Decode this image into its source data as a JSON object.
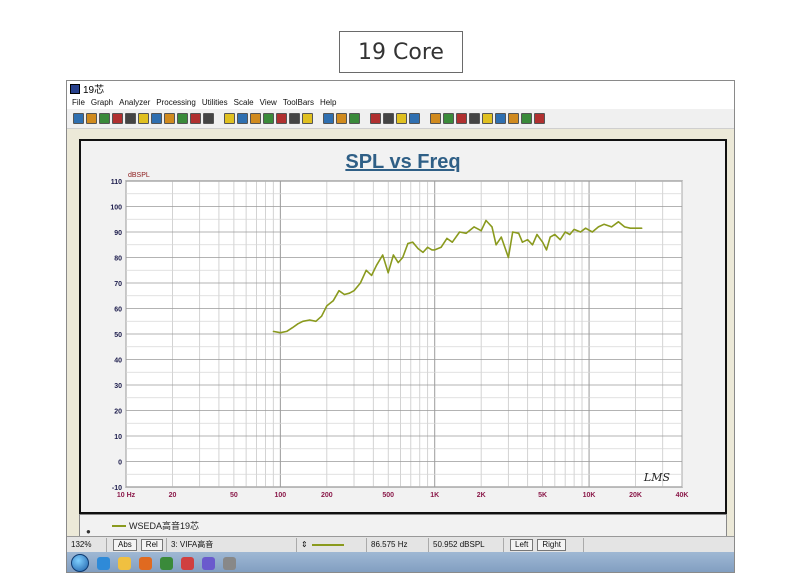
{
  "caption": "19 Core",
  "window": {
    "title": "19芯"
  },
  "menu": [
    "File",
    "Graph",
    "Analyzer",
    "Processing",
    "Utilities",
    "Scale",
    "View",
    "ToolBars",
    "Help"
  ],
  "toolbar": {
    "icons": [
      "new-icon",
      "open-icon",
      "open-folder-icon",
      "save-icon",
      "save-as-icon",
      "copy-icon",
      "paste-icon",
      "export-icon",
      "print-icon",
      "settings-icon",
      "red-diamond-icon",
      "zoom-in-icon",
      "zoom-out-icon",
      "zoom-fit-icon",
      "zoom-x-icon",
      "zoom-y-icon",
      "refresh-icon",
      "lock-icon",
      "grid-icon",
      "list-icon",
      "undo-icon",
      "measure-icon",
      "compare-icon",
      "record-icon",
      "play-icon",
      "green-icon",
      "red-icon",
      "black-icon",
      "marker-icon",
      "cursor-icon",
      "cross-icon",
      "link-icon",
      "target-icon",
      "tool-icon"
    ],
    "colors": [
      "#2f6fb0",
      "#d08a1e",
      "#3a8a3a",
      "#b03030",
      "#444444",
      "#e0c020"
    ]
  },
  "chart_data": {
    "type": "line",
    "title": "SPL vs Freq",
    "ylabel": "dBSPL",
    "xlabel": "",
    "xscale": "log",
    "xlim": [
      10,
      40000
    ],
    "ylim": [
      -10,
      110
    ],
    "grid": true,
    "x_ticks": [
      {
        "v": 10,
        "label": "10 Hz"
      },
      {
        "v": 20,
        "label": "20"
      },
      {
        "v": 50,
        "label": "50"
      },
      {
        "v": 100,
        "label": "100"
      },
      {
        "v": 200,
        "label": "200"
      },
      {
        "v": 500,
        "label": "500"
      },
      {
        "v": 1000,
        "label": "1K"
      },
      {
        "v": 2000,
        "label": "2K"
      },
      {
        "v": 5000,
        "label": "5K"
      },
      {
        "v": 10000,
        "label": "10K"
      },
      {
        "v": 20000,
        "label": "20K"
      },
      {
        "v": 40000,
        "label": "40K"
      }
    ],
    "y_ticks": [
      -10,
      0,
      10,
      20,
      30,
      40,
      50,
      60,
      70,
      80,
      90,
      100,
      110
    ],
    "watermark": "LMS",
    "series": [
      {
        "name": "WSEDA高音19芯",
        "color": "#8a9a1e",
        "x": [
          90,
          100,
          110,
          120,
          130,
          140,
          155,
          170,
          185,
          200,
          220,
          240,
          260,
          280,
          300,
          330,
          360,
          390,
          420,
          460,
          500,
          540,
          580,
          620,
          670,
          720,
          780,
          840,
          900,
          960,
          1000,
          1100,
          1200,
          1300,
          1450,
          1600,
          1800,
          2000,
          2150,
          2350,
          2500,
          2700,
          3000,
          3200,
          3500,
          3700,
          4000,
          4300,
          4600,
          5000,
          5300,
          5600,
          6000,
          6500,
          7000,
          7500,
          8000,
          8800,
          9500,
          10500,
          11500,
          12500,
          14000,
          15500,
          17000,
          18500,
          20000,
          22000
        ],
        "y": [
          51,
          50.5,
          51,
          52.5,
          54,
          55,
          55.5,
          55,
          57,
          61,
          63,
          67,
          65.5,
          66,
          67,
          70,
          75,
          73,
          77,
          81,
          74,
          81,
          78,
          80,
          85.5,
          86,
          83.5,
          82,
          84,
          83,
          83,
          84,
          87.5,
          86,
          90,
          89.5,
          92,
          90.5,
          94.5,
          92,
          85,
          88,
          80,
          90,
          89.5,
          86,
          87,
          85,
          89,
          86,
          83,
          88,
          89,
          87,
          90,
          89,
          91,
          90,
          91.5,
          90,
          92,
          93,
          92,
          94,
          92,
          91.5,
          91.5,
          91.5
        ]
      }
    ]
  },
  "legend": {
    "label": "WSEDA高音19芯"
  },
  "statusbar": {
    "zoom": "132%",
    "abs": "Abs",
    "rel": "Rel",
    "channel": "3: VIFA高音",
    "freq": "86.575 Hz",
    "level": "50.952 dBSPL",
    "left": "Left",
    "right": "Right"
  },
  "taskbar": {
    "icons": [
      "start-orb-icon",
      "ie-icon",
      "folder-icon",
      "media-icon",
      "app-icon",
      "chrome-icon",
      "lms-icon",
      "explorer-icon"
    ],
    "colors": [
      "#2e8ad8",
      "#f0c040",
      "#e06a20",
      "#3a8a3a",
      "#d04040",
      "#6a5acd",
      "#888888"
    ]
  }
}
